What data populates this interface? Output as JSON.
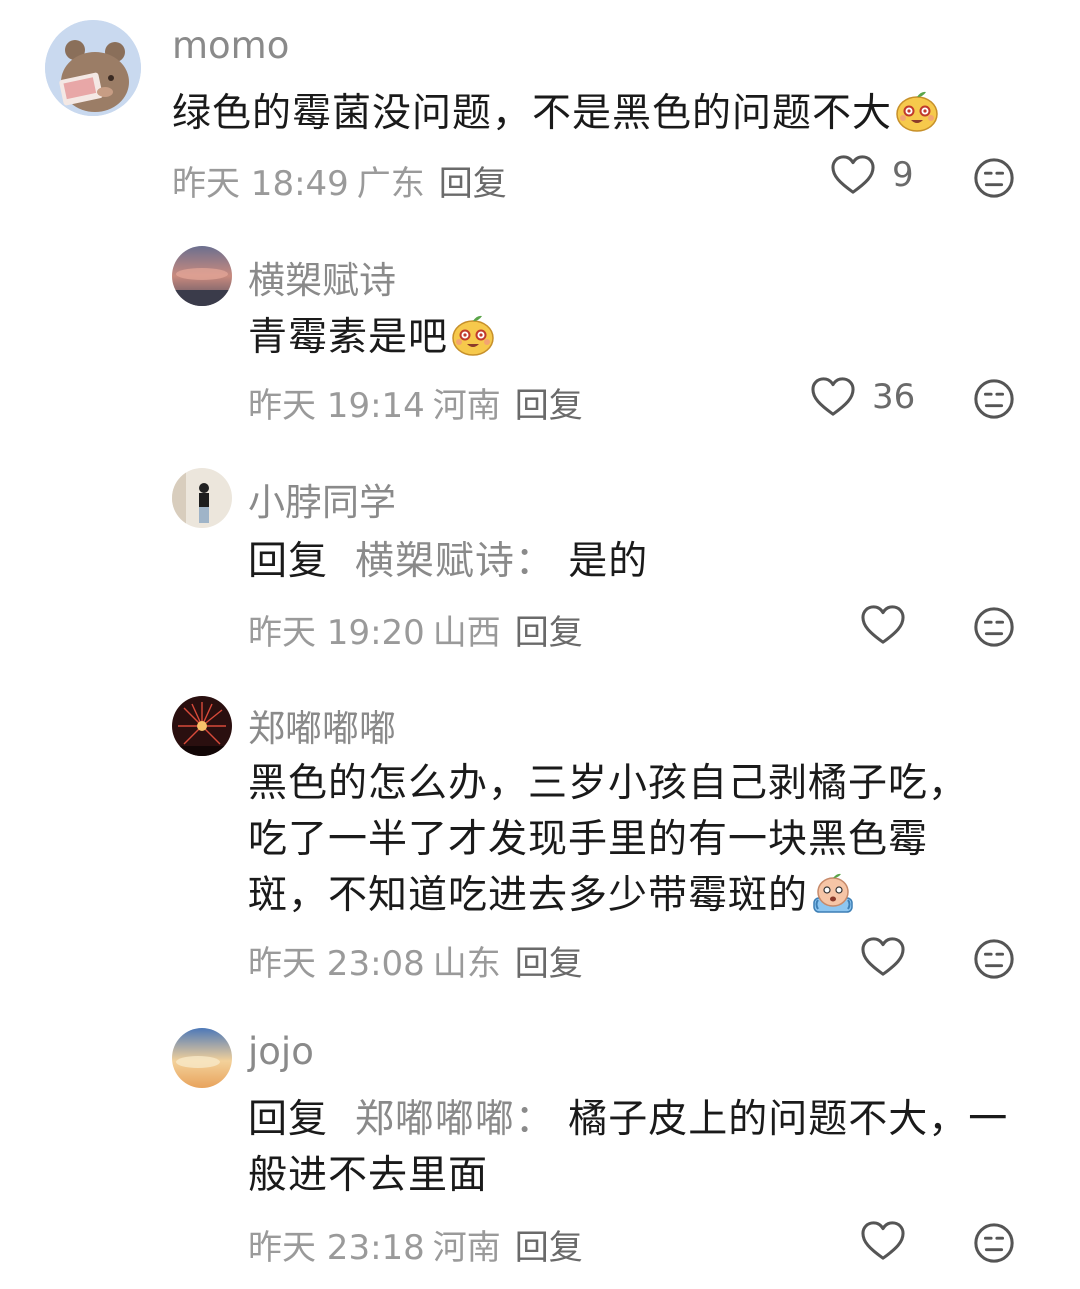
{
  "comments": [
    {
      "user": "momo",
      "text": "绿色的霉菌没问题，不是黑色的问题不大",
      "emoji": "laughing-orange-emoji",
      "time": "昨天 18:49",
      "region": "广东",
      "reply_label": "回复",
      "likes": "9"
    },
    {
      "user": "横槊赋诗",
      "text": "青霉素是吧",
      "emoji": "laughing-orange-emoji",
      "time": "昨天 19:14",
      "region": "河南",
      "reply_label": "回复",
      "likes": "36"
    },
    {
      "user": "小脖同学",
      "reply_prefix": "回复",
      "reply_target": "横槊赋诗：",
      "text": "是的",
      "time": "昨天 19:20",
      "region": "山西",
      "reply_label": "回复",
      "likes": ""
    },
    {
      "user": "郑嘟嘟嘟",
      "text": "黑色的怎么办，三岁小孩自己剥橘子吃，吃了一半了才发现手里的有一块黑色霉斑，不知道吃进去多少带霉斑的",
      "emoji": "scared-orange-emoji",
      "time": "昨天 23:08",
      "region": "山东",
      "reply_label": "回复",
      "likes": ""
    },
    {
      "user": "jojo",
      "reply_prefix": "回复",
      "reply_target": "郑嘟嘟嘟：",
      "text": "橘子皮上的问题不大，一般进不去里面",
      "time": "昨天 23:18",
      "region": "河南",
      "reply_label": "回复",
      "likes": ""
    }
  ],
  "icons": {
    "like": "heart-outline-icon",
    "dislike": "meh-face-icon"
  },
  "colors": {
    "text": "#1a1a1a",
    "muted": "#8a8a8a",
    "icon": "#555555"
  }
}
